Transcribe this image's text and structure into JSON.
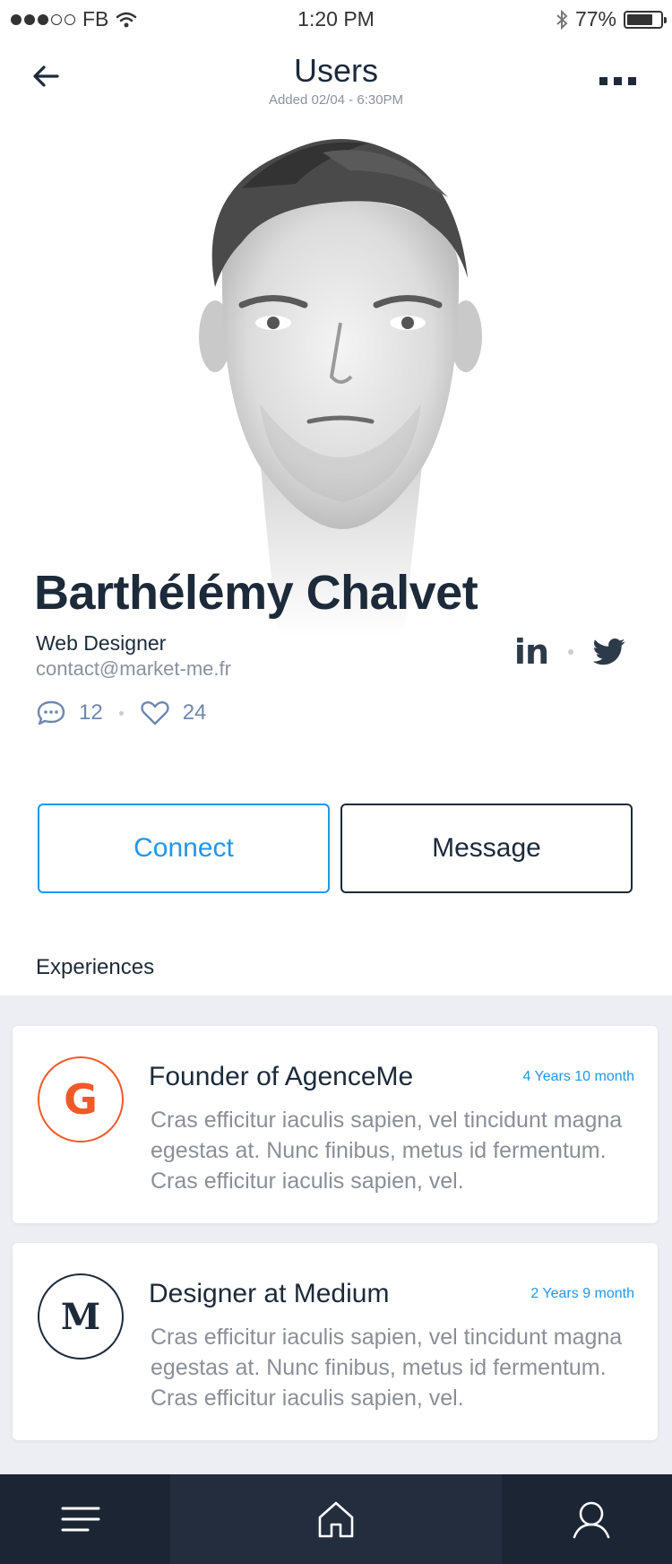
{
  "status_bar": {
    "carrier": "FB",
    "time": "1:20 PM",
    "battery_percent": "77%",
    "battery_level": 0.77
  },
  "header": {
    "title": "Users",
    "subtitle": "Added 02/04 - 6:30PM"
  },
  "profile": {
    "name": "Barthélémy Chalvet",
    "role": "Web Designer",
    "email": "contact@market-me.fr",
    "comments_count": "12",
    "likes_count": "24",
    "linkedin_label": "in"
  },
  "actions": {
    "connect_label": "Connect",
    "message_label": "Message"
  },
  "experiences": {
    "section_title": "Experiences",
    "items": [
      {
        "logo_letter": "G",
        "title": "Founder of AgenceMe",
        "duration": "4 Years 10 month",
        "description": "Cras efficitur iaculis sapien, vel tincidunt magna egestas at. Nunc finibus, metus id fermentum. Cras efficitur iaculis sapien, vel."
      },
      {
        "logo_letter": "M",
        "title": "Designer at Medium",
        "duration": "2 Years 9 month",
        "description": "Cras efficitur iaculis sapien, vel tincidunt magna egestas at. Nunc finibus, metus id fermentum. Cras efficitur iaculis sapien, vel."
      }
    ]
  },
  "colors": {
    "accent": "#2196e8",
    "dark": "#1c2a3a",
    "google_orange": "#f05a28",
    "nav_bg": "#1c2533"
  },
  "icons": {
    "back": "arrow-left-icon",
    "more": "more-horizontal-icon",
    "comment": "comment-icon",
    "like": "heart-icon",
    "linkedin": "linkedin-icon",
    "twitter": "twitter-icon",
    "menu": "menu-icon",
    "home": "home-icon",
    "profile": "user-icon"
  }
}
